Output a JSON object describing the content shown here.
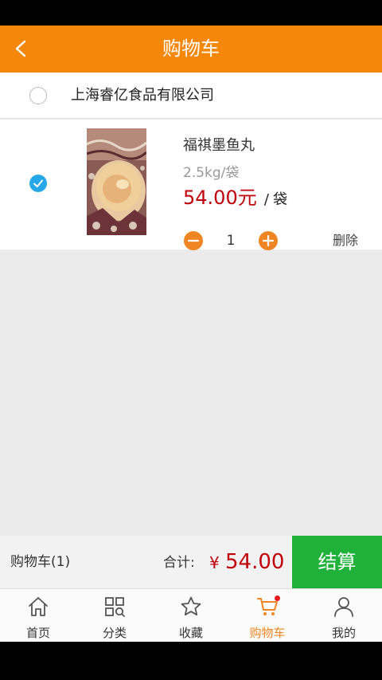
{
  "header": {
    "title": "购物车"
  },
  "shop": {
    "name": "上海睿亿食品有限公司",
    "selected": false
  },
  "item": {
    "name": "福祺墨鱼丸",
    "spec": "2.5kg/袋",
    "price": "54.00元",
    "separator": "/",
    "unit": "袋",
    "quantity": "1",
    "delete_label": "删除",
    "selected": true
  },
  "checkout": {
    "cart_label": "购物车(1)",
    "total_label": "合计:",
    "currency": "¥",
    "total_value": "54.00",
    "pay_label": "结算"
  },
  "tabs": [
    {
      "label": "首页",
      "icon": "home-icon"
    },
    {
      "label": "分类",
      "icon": "category-icon"
    },
    {
      "label": "收藏",
      "icon": "star-icon"
    },
    {
      "label": "购物车",
      "icon": "cart-icon",
      "active": true
    },
    {
      "label": "我的",
      "icon": "user-icon"
    }
  ],
  "colors": {
    "header": "#f5870a",
    "accent": "#f08623",
    "price": "#c0000a",
    "pay_button": "#1fb13a",
    "checkbox_checked": "#26a7e8"
  }
}
